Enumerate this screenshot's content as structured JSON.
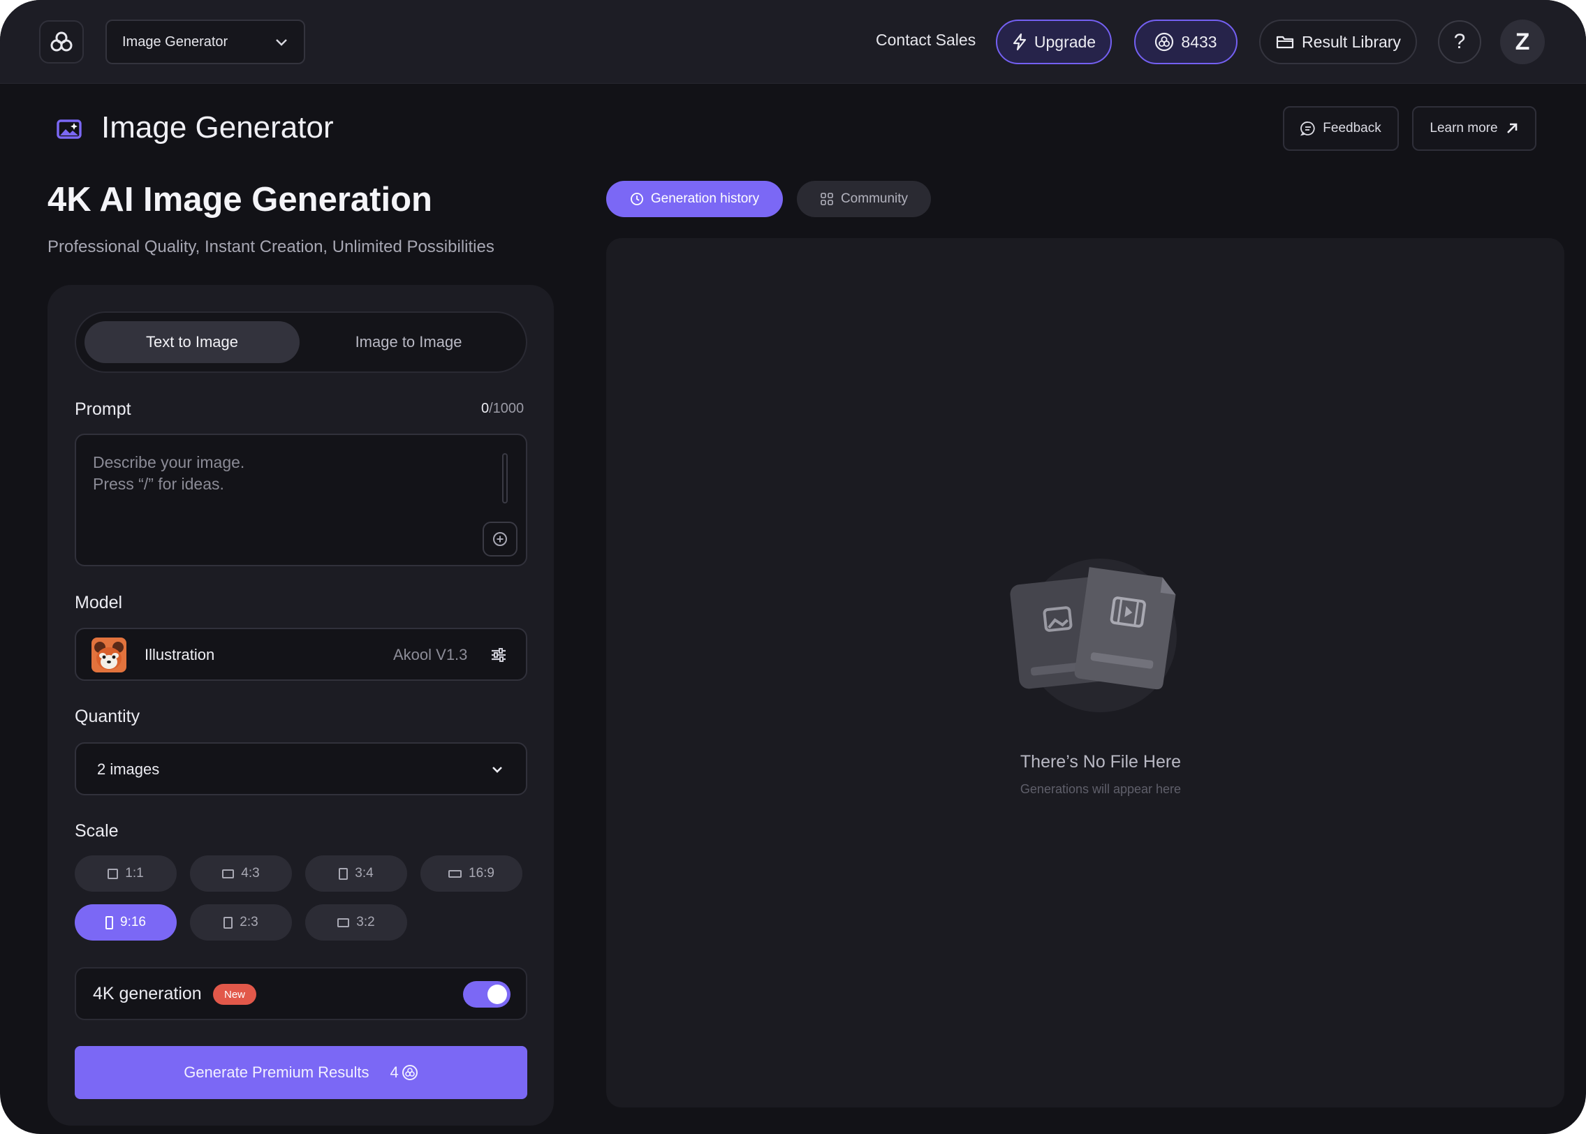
{
  "topbar": {
    "app_selector": "Image Generator",
    "contact_sales": "Contact Sales",
    "upgrade": "Upgrade",
    "credits": "8433",
    "result_library": "Result Library",
    "help": "?",
    "avatar_initial": "Z"
  },
  "header": {
    "title": "Image Generator",
    "feedback": "Feedback",
    "learn_more": "Learn more"
  },
  "hero": {
    "headline": "4K AI Image Generation",
    "subline": "Professional Quality, Instant Creation, Unlimited Possibilities"
  },
  "form": {
    "mode_tabs": [
      "Text to Image",
      "Image to Image"
    ],
    "active_mode": "Text to Image",
    "prompt_label": "Prompt",
    "prompt_count": "0",
    "prompt_max": "/1000",
    "prompt_placeholder": "Describe your image.\nPress “/” for ideas.",
    "prompt_value": "",
    "model_label": "Model",
    "model_name": "Illustration",
    "model_version": "Akool V1.3",
    "quantity_label": "Quantity",
    "quantity_value": "2 images",
    "scale_label": "Scale",
    "scales": [
      {
        "label": "1:1",
        "shape": "square"
      },
      {
        "label": "4:3",
        "shape": "landscape"
      },
      {
        "label": "3:4",
        "shape": "portrait"
      },
      {
        "label": "16:9",
        "shape": "wide"
      },
      {
        "label": "9:16",
        "shape": "tall"
      },
      {
        "label": "2:3",
        "shape": "portrait"
      },
      {
        "label": "3:2",
        "shape": "landscape"
      }
    ],
    "selected_scale": "9:16",
    "k4_label": "4K generation",
    "k4_badge": "New",
    "k4_enabled": true,
    "generate_label": "Generate Premium Results",
    "generate_cost": "4"
  },
  "results": {
    "tabs": [
      "Generation history",
      "Community"
    ],
    "active_tab": "Generation history",
    "empty_title": "There’s No File Here",
    "empty_subtitle": "Generations will appear here"
  },
  "colors": {
    "accent": "#7b68f5",
    "background": "#121217",
    "panel": "#1c1c23",
    "badge_new": "#e2584a"
  },
  "icons": {
    "logo": "brand-knot-icon",
    "chevron": "chevron-down-icon",
    "upgrade": "lightning-icon",
    "credits": "credit-coin-icon",
    "library": "folder-icon",
    "feedback": "chat-bubble-icon",
    "learn_more": "arrow-up-right-icon",
    "history": "clock-icon",
    "community": "grid-icon",
    "prompt_action": "plus-circle-icon",
    "model_settings": "sliders-icon"
  }
}
